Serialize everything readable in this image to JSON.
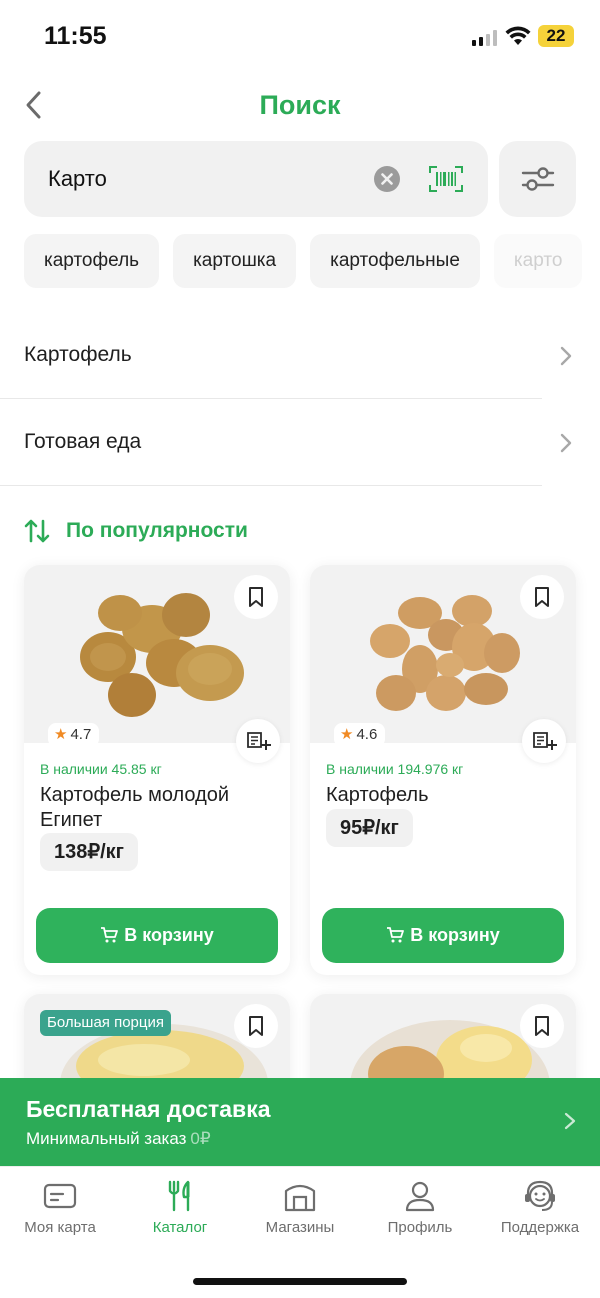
{
  "status_bar": {
    "time": "11:55",
    "battery": "22"
  },
  "header": {
    "title": "Поиск"
  },
  "search": {
    "value": "Карто"
  },
  "suggestions": [
    "картофель",
    "картошка",
    "картофельные",
    "карто"
  ],
  "categories": [
    {
      "label": "Картофель"
    },
    {
      "label": "Готовая еда"
    }
  ],
  "sort": {
    "label": "По популярности"
  },
  "products": [
    {
      "rating": "4.7",
      "stock": "В наличии 45.85 кг",
      "name": "Картофель молодой Египет",
      "price": "138₽/кг",
      "cart_label": "В корзину"
    },
    {
      "rating": "4.6",
      "stock": "В наличии 194.976 кг",
      "name": "Картофель",
      "price": "95₽/кг",
      "cart_label": "В корзину"
    },
    {
      "badge": "Большая порция"
    },
    {}
  ],
  "delivery": {
    "title": "Бесплатная доставка",
    "subtitle": "Минимальный заказ",
    "min_value": "0₽"
  },
  "tabs": [
    {
      "label": "Моя карта",
      "icon": "card-icon"
    },
    {
      "label": "Каталог",
      "icon": "fork-knife-icon",
      "active": true
    },
    {
      "label": "Магазины",
      "icon": "store-icon"
    },
    {
      "label": "Профиль",
      "icon": "person-icon"
    },
    {
      "label": "Поддержка",
      "icon": "support-icon"
    }
  ],
  "colors": {
    "accent": "#2cab57",
    "button": "#2fb25c",
    "badge": "#3aa38d",
    "star": "#f08a24"
  }
}
